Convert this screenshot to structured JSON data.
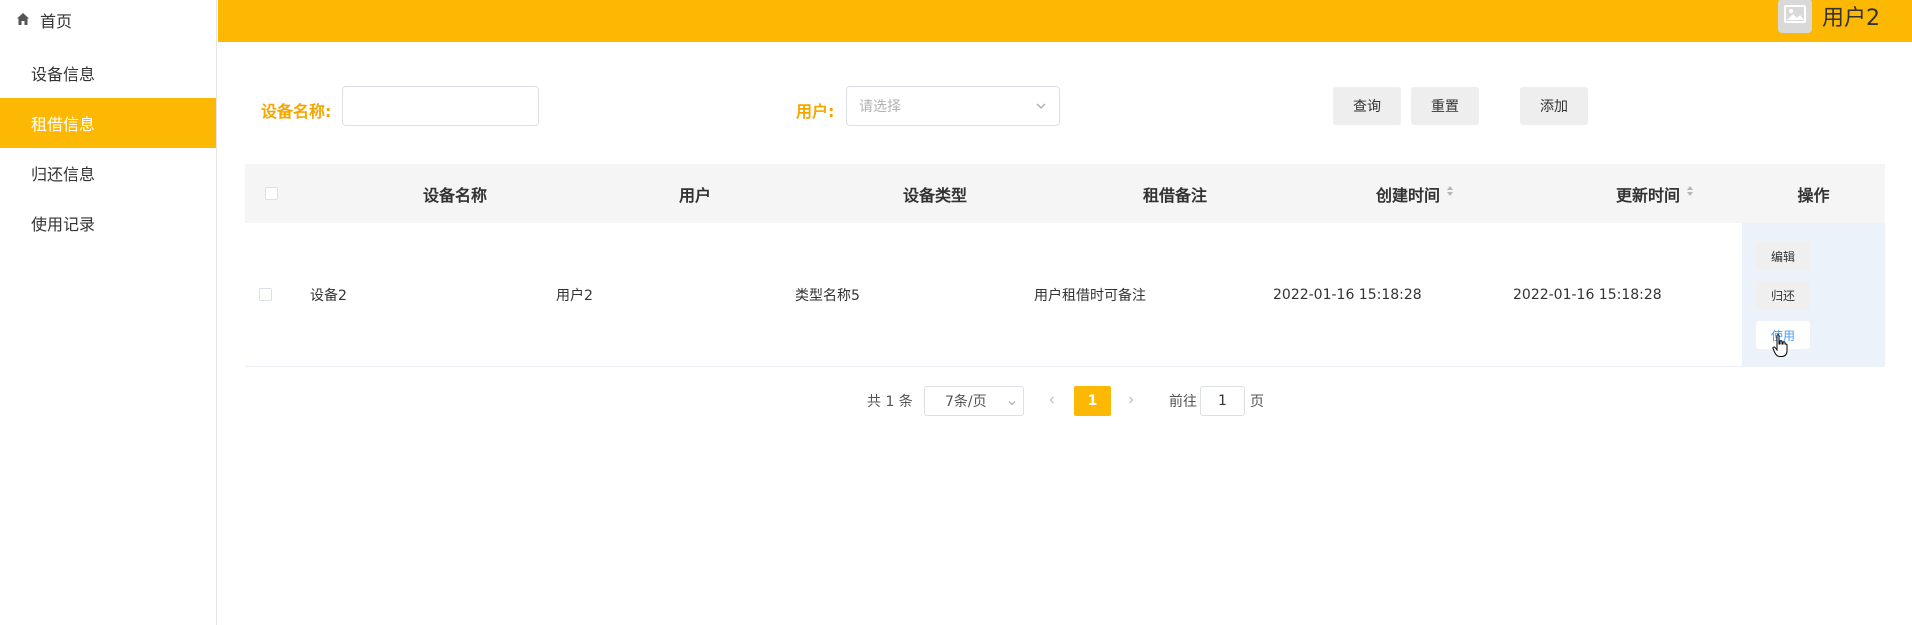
{
  "sidebar": {
    "home_label": "首页",
    "items": [
      {
        "label": "设备信息"
      },
      {
        "label": "租借信息"
      },
      {
        "label": "归还信息"
      },
      {
        "label": "使用记录"
      }
    ]
  },
  "header": {
    "username": "用户2"
  },
  "search": {
    "device_name_label": "设备名称:",
    "device_name_value": "",
    "user_label": "用户:",
    "user_placeholder": "请选择",
    "query_label": "查询",
    "reset_label": "重置",
    "add_label": "添加"
  },
  "table": {
    "columns": [
      "设备名称",
      "用户",
      "设备类型",
      "租借备注",
      "创建时间",
      "更新时间",
      "操作"
    ],
    "rows": [
      {
        "device_name": "设备2",
        "user": "用户2",
        "device_type": "类型名称5",
        "remark": "用户租借时可备注",
        "created": "2022-01-16 15:18:28",
        "updated": "2022-01-16 15:18:28",
        "actions": [
          "编辑",
          "归还",
          "使用"
        ]
      }
    ]
  },
  "pagination": {
    "total_text": "共 1 条",
    "page_size": "7条/页",
    "current_page": "1",
    "goto_label": "前往",
    "goto_value": "1",
    "page_suffix": "页"
  },
  "colors": {
    "accent": "#fdb803",
    "label": "#f5a700",
    "ops_bg": "#ecf2f9",
    "link": "#409eff"
  }
}
